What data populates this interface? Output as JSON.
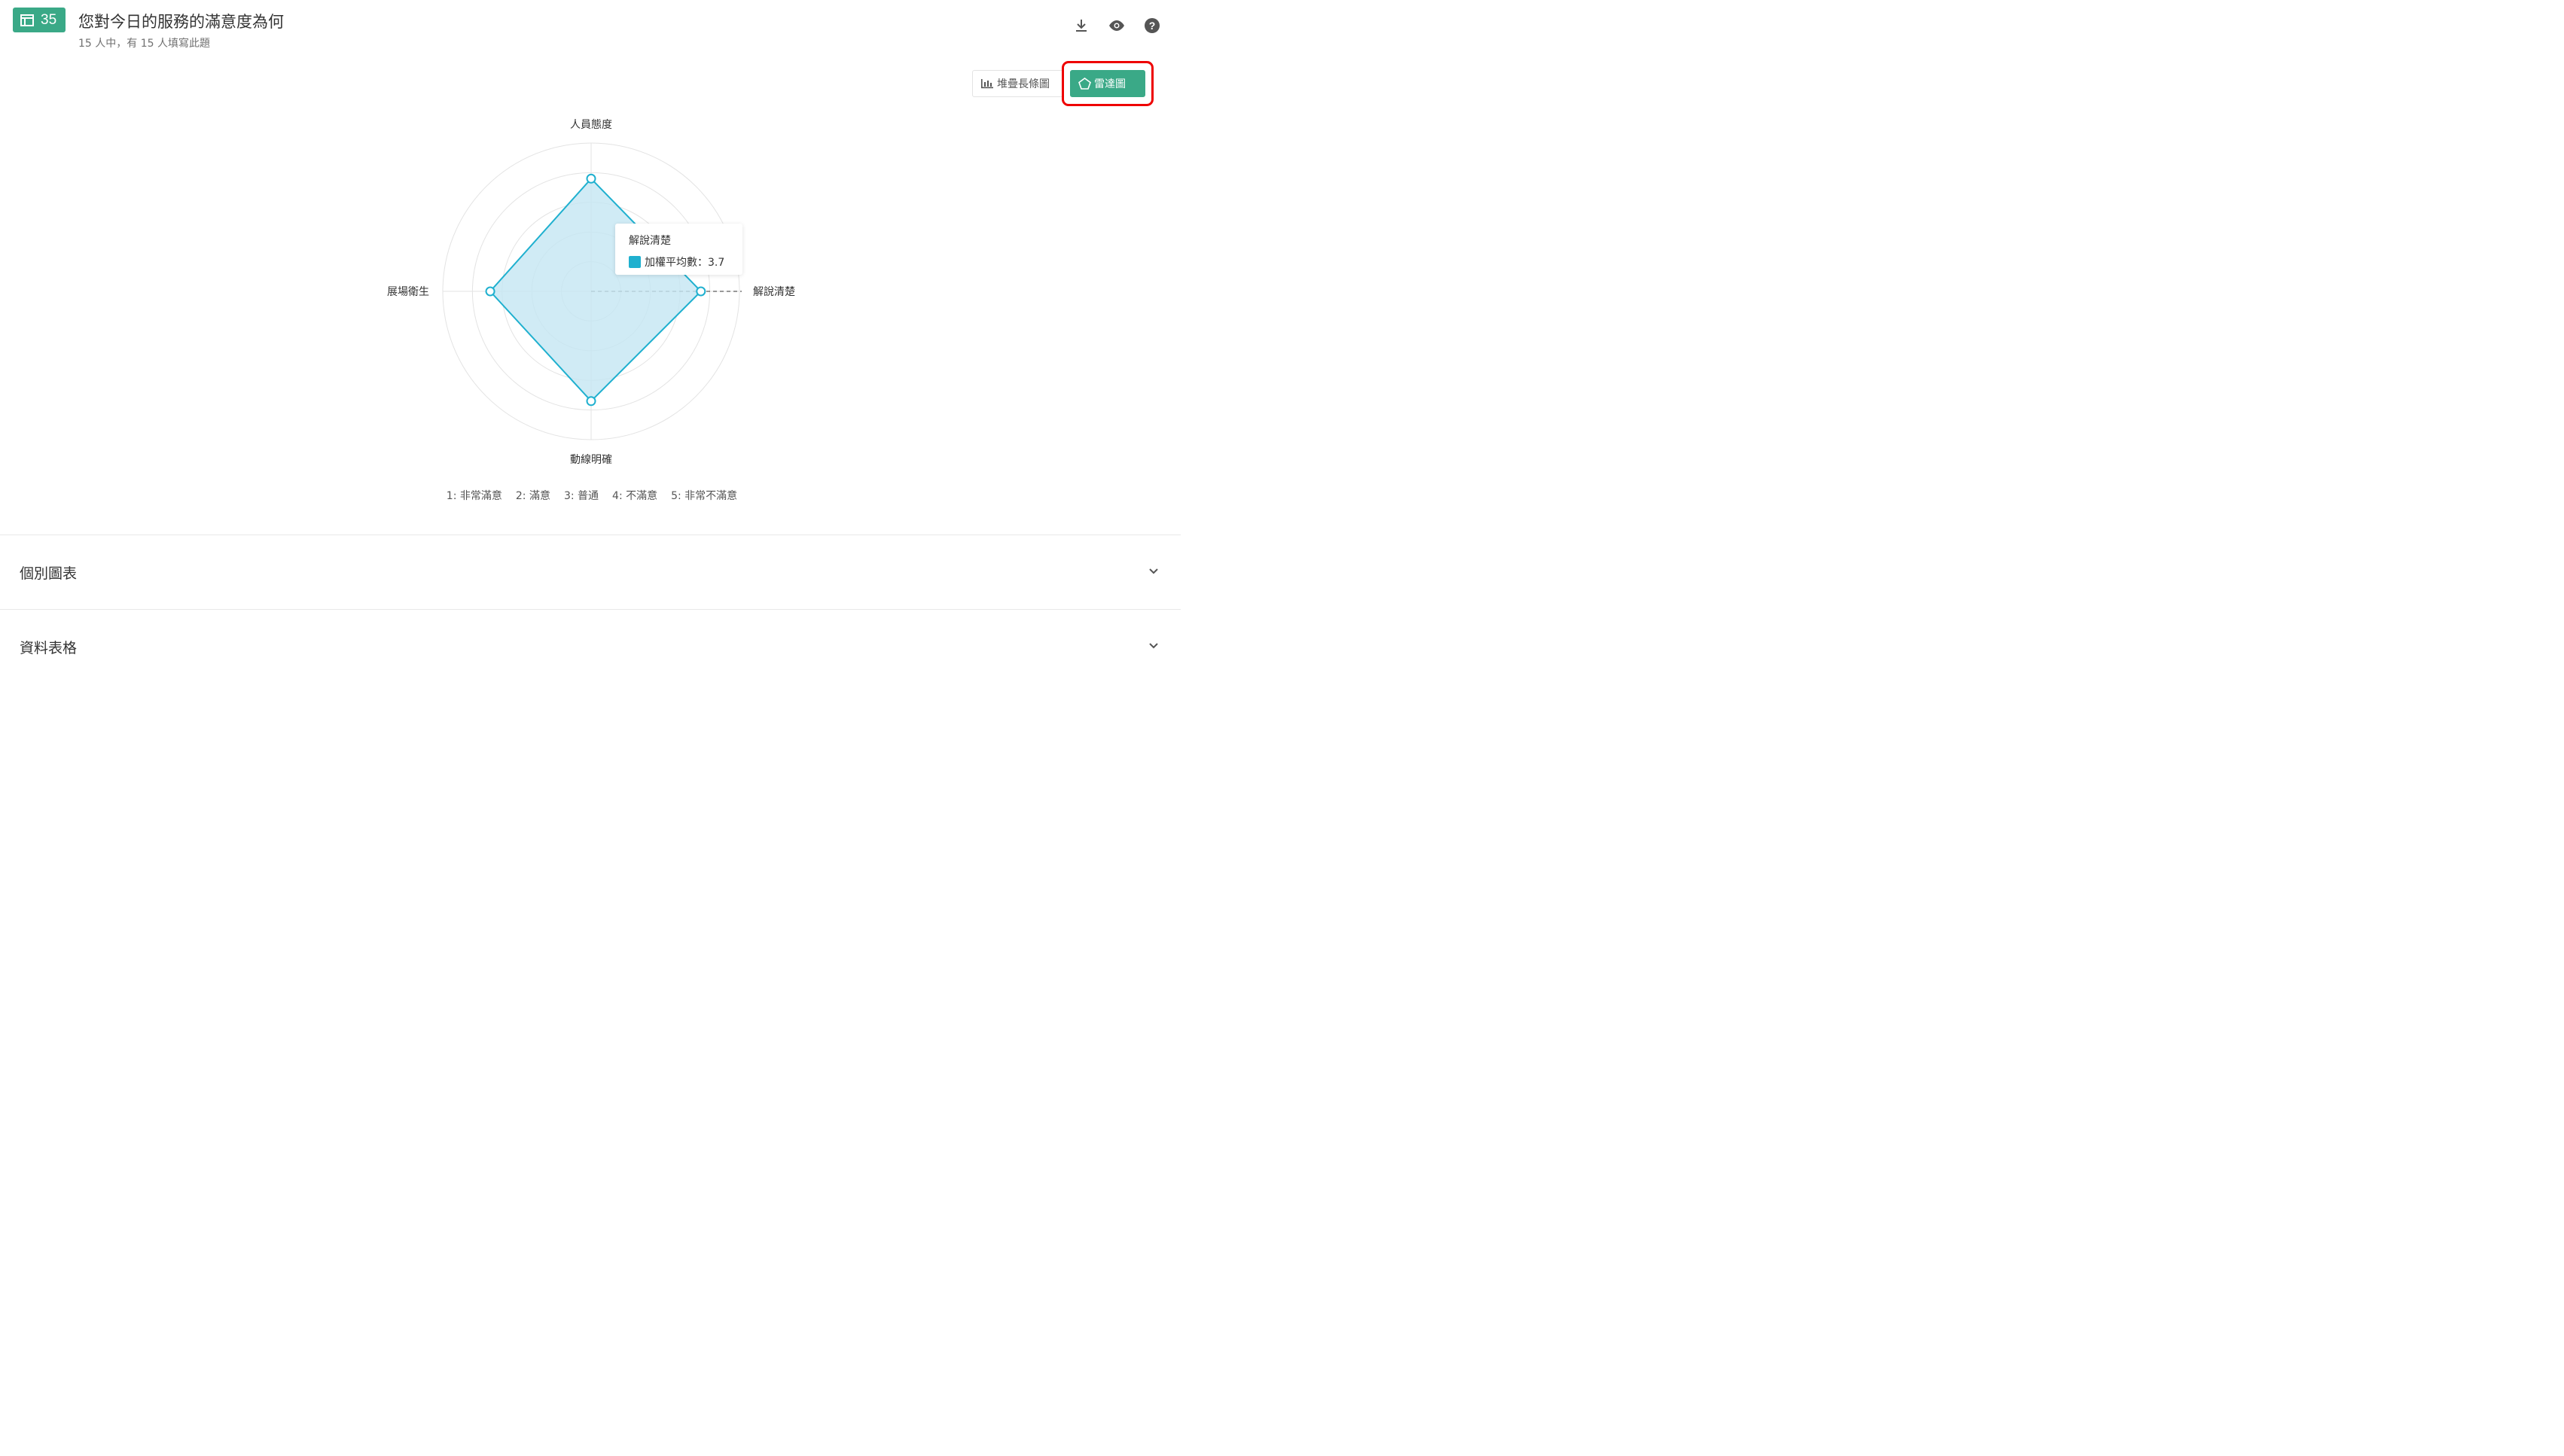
{
  "question": {
    "number": "35",
    "title": "您對今日的服務的滿意度為何",
    "subtitle": "15 人中，有 15 人填寫此題"
  },
  "toolbar": {
    "icons": [
      "download-icon",
      "eye-icon",
      "help-icon"
    ]
  },
  "view_toggle": {
    "stacked_label": "堆疊長條圖",
    "radar_label": "雷達圖",
    "active": "radar"
  },
  "chart_data": {
    "type": "radar",
    "axes": [
      "人員態度",
      "解說清楚",
      "動線明確",
      "展場衛生"
    ],
    "series": [
      {
        "values": [
          3.8,
          3.7,
          3.7,
          3.4
        ]
      }
    ],
    "rmax": 5,
    "rings": 5,
    "fill_color": "#c4e6f3",
    "line_color": "#1fb0cf"
  },
  "tooltip": {
    "category": "解說清楚",
    "label": "加權平均數：3.7"
  },
  "scale_legend": [
    "1: 非常滿意",
    "2: 滿意",
    "3: 普通",
    "4: 不滿意",
    "5: 非常不滿意"
  ],
  "sections": [
    {
      "label": "個別圖表"
    },
    {
      "label": "資料表格"
    }
  ],
  "colors": {
    "accent": "#3aa987",
    "highlight": "#ee0000"
  }
}
